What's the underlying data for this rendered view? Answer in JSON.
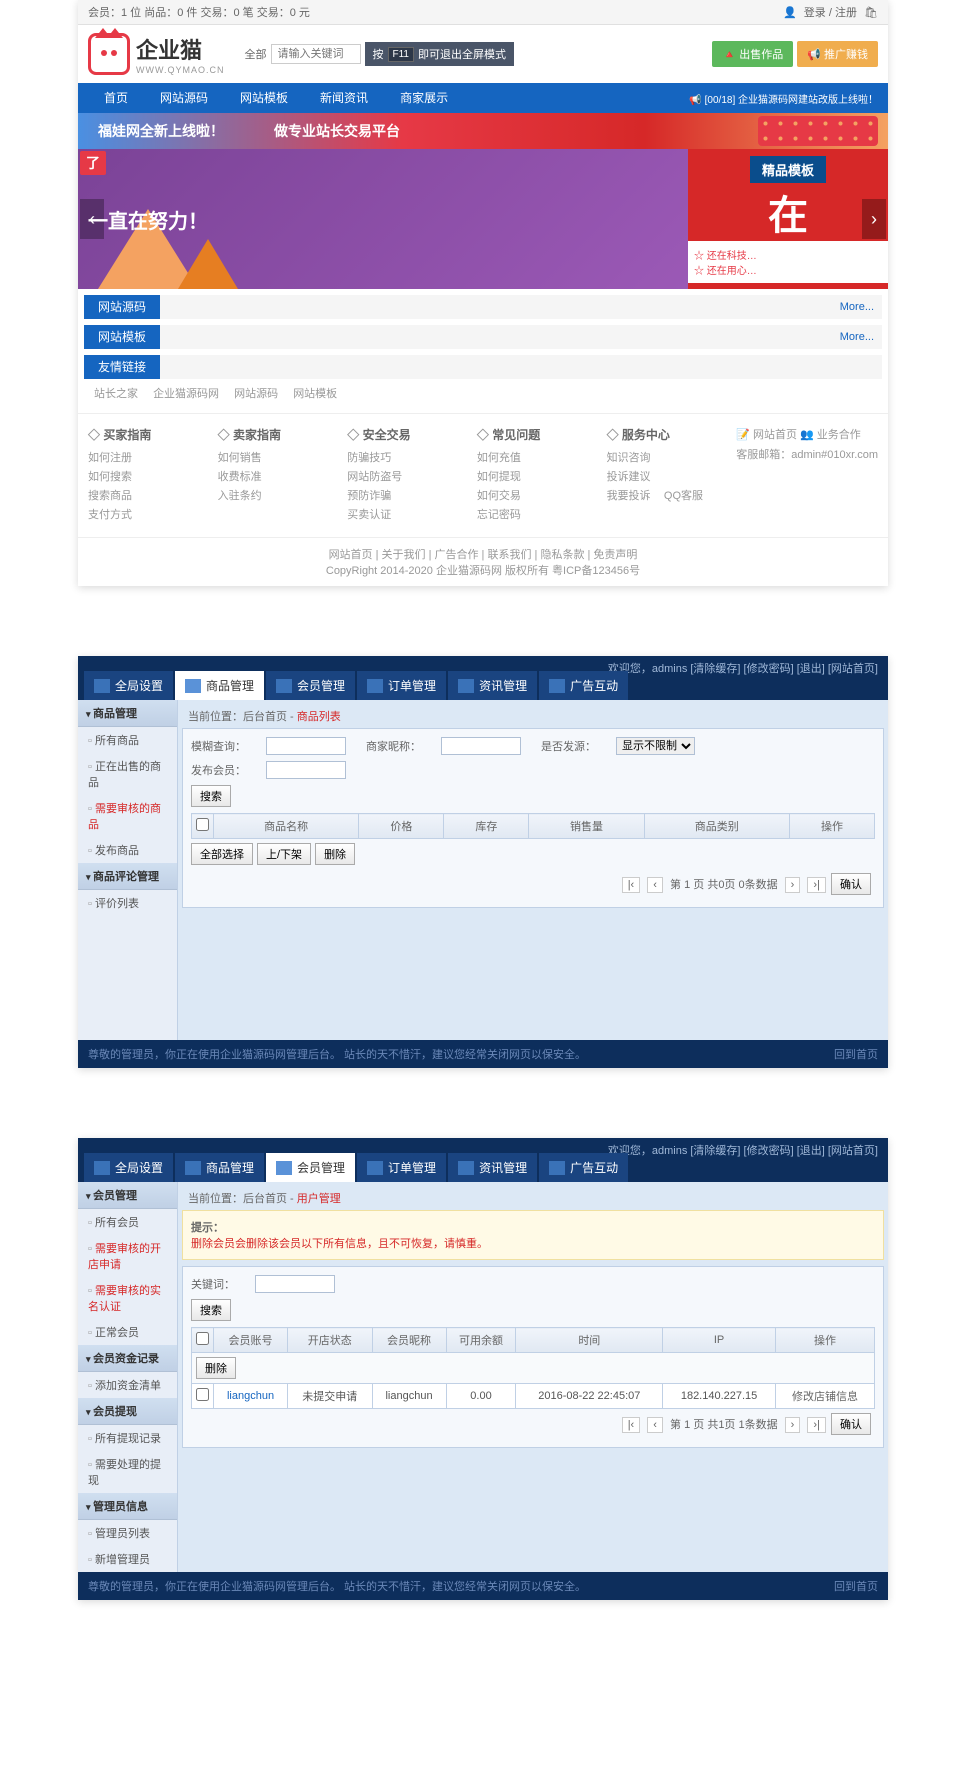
{
  "p1": {
    "topbar_left": "会员：1 位  尚品：0 件  交易：0 笔  交易：0 元",
    "topbar_login": "登录 / 注册",
    "logo_text": "企业猫",
    "logo_sub": "WWW.QYMAO.CN",
    "search_label": "全部",
    "search_placeholder": "请输入关键词",
    "f11_pre": "按",
    "f11_key": "F11",
    "f11_post": "即可退出全屏模式",
    "btn_green": "🔺 出售作品",
    "btn_orange": "📢 推广赚钱",
    "nav": [
      "首页",
      "网站源码",
      "网站模板",
      "新闻资讯",
      "商家展示"
    ],
    "nav_announce": "📢 [00/18] 企业猫源码网建站改版上线啦！",
    "banner1_t1": "福娃网全新上线啦！",
    "banner1_t2": "做专业站长交易平台",
    "hero_badge": "了",
    "hero_left": "一直在努力！",
    "hero_right_top": "精品模板",
    "hero_right_big": "在",
    "hero_star1": "☆ 还在科技…",
    "hero_star2": "☆ 还在用心…",
    "sections": [
      {
        "title": "网站源码",
        "more": "More..."
      },
      {
        "title": "网站模板",
        "more": "More..."
      },
      {
        "title": "友情链接",
        "more": ""
      }
    ],
    "friend_links": [
      "站长之家",
      "企业猫源码网",
      "网站源码",
      "网站模板"
    ],
    "footer_cols": [
      {
        "title": "买家指南",
        "links": [
          "如何注册",
          "如何搜索",
          "搜索商品",
          "支付方式"
        ]
      },
      {
        "title": "卖家指南",
        "links": [
          "如何销售",
          "收费标准",
          "入驻条约"
        ]
      },
      {
        "title": "安全交易",
        "links": [
          "防骗技巧",
          "网站防盗号",
          "预防诈骗",
          "买卖认证"
        ]
      },
      {
        "title": "常见问题",
        "links": [
          "如何充值",
          "如何提现",
          "如何交易",
          "忘记密码"
        ]
      },
      {
        "title": "服务中心",
        "links": [
          "知识咨询",
          "投诉建议",
          "我要投诉",
          "QQ客服"
        ]
      }
    ],
    "footer_contact1": "📝 网站首页    👥 业务合作",
    "footer_contact2": "客服邮箱：admin#010xr.com",
    "bottom_links": "网站首页 | 关于我们 | 广告合作 | 联系我们 | 隐私条款 | 免责声明",
    "copyright": "CopyRight 2014-2020 企业猫源码网 版权所有 粤ICP备123456号"
  },
  "p2": {
    "welcome": "欢迎您，admins [清除缓存] [修改密码] [退出] [网站首页]",
    "tabs": [
      "全局设置",
      "商品管理",
      "会员管理",
      "订单管理",
      "资讯管理",
      "广告互动"
    ],
    "active_tab": 1,
    "side_groups": [
      {
        "title": "商品管理",
        "items": [
          {
            "label": "所有商品",
            "red": false
          },
          {
            "label": "正在出售的商品",
            "red": false
          },
          {
            "label": "需要审核的商品",
            "red": true
          },
          {
            "label": "发布商品",
            "red": false
          }
        ]
      },
      {
        "title": "商品评论管理",
        "items": [
          {
            "label": "评价列表",
            "red": false
          }
        ]
      }
    ],
    "crumb_pre": "当前位置：后台首页 - ",
    "crumb_cur": "商品列表",
    "form": {
      "l1": "模糊查询：",
      "l2": "商家昵称：",
      "l3": "是否发源：",
      "l4": "发布会员：",
      "select_opt": "显示不限制",
      "btn_search": "搜索"
    },
    "table_headers": [
      "",
      "商品名称",
      "价格",
      "库存",
      "销售量",
      "商品类别",
      "操作"
    ],
    "action_btns": [
      "全部选择",
      "上/下架",
      "删除"
    ],
    "pager": "第 1 页  共0页 0条数据",
    "pager_ok": "确认",
    "footer_left": "尊敬的管理员，你正在使用企业猫源码网管理后台。 站长的天不惜汗，建议您经常关闭网页以保安全。",
    "footer_right": "回到首页"
  },
  "p3": {
    "welcome": "欢迎您，admins [清除缓存] [修改密码] [退出] [网站首页]",
    "tabs": [
      "全局设置",
      "商品管理",
      "会员管理",
      "订单管理",
      "资讯管理",
      "广告互动"
    ],
    "active_tab": 2,
    "side_groups": [
      {
        "title": "会员管理",
        "items": [
          {
            "label": "所有会员",
            "red": false
          },
          {
            "label": "需要审核的开店申请",
            "red": true
          },
          {
            "label": "需要审核的实名认证",
            "red": true
          },
          {
            "label": "正常会员",
            "red": false
          }
        ]
      },
      {
        "title": "会员资金记录",
        "items": [
          {
            "label": "添加资金清单",
            "red": false
          }
        ]
      },
      {
        "title": "会员提现",
        "items": [
          {
            "label": "所有提现记录",
            "red": false
          },
          {
            "label": "需要处理的提现",
            "red": false
          }
        ]
      },
      {
        "title": "管理员信息",
        "items": [
          {
            "label": "管理员列表",
            "red": false
          },
          {
            "label": "新增管理员",
            "red": false
          }
        ]
      }
    ],
    "crumb_pre": "当前位置：后台首页 - ",
    "crumb_cur": "用户管理",
    "warn_title": "提示：",
    "warn_text": "删除会员会删除该会员以下所有信息，且不可恢复，请慎重。",
    "form_label": "关键词：",
    "form_btn": "搜索",
    "table_headers": [
      "",
      "会员账号",
      "开店状态",
      "会员昵称",
      "可用余额",
      "时间",
      "IP",
      "操作"
    ],
    "del_btn": "删除",
    "row": {
      "account": "liangchun",
      "shop": "未提交申请",
      "nick": "liangchun",
      "balance": "0.00",
      "time": "2016-08-22 22:45:07",
      "ip": "182.140.227.15",
      "op": "修改店铺信息"
    },
    "pager": "第 1 页  共1页 1条数据",
    "pager_ok": "确认",
    "footer_left": "尊敬的管理员，你正在使用企业猫源码网管理后台。 站长的天不惜汗，建议您经常关闭网页以保安全。",
    "footer_right": "回到首页"
  }
}
